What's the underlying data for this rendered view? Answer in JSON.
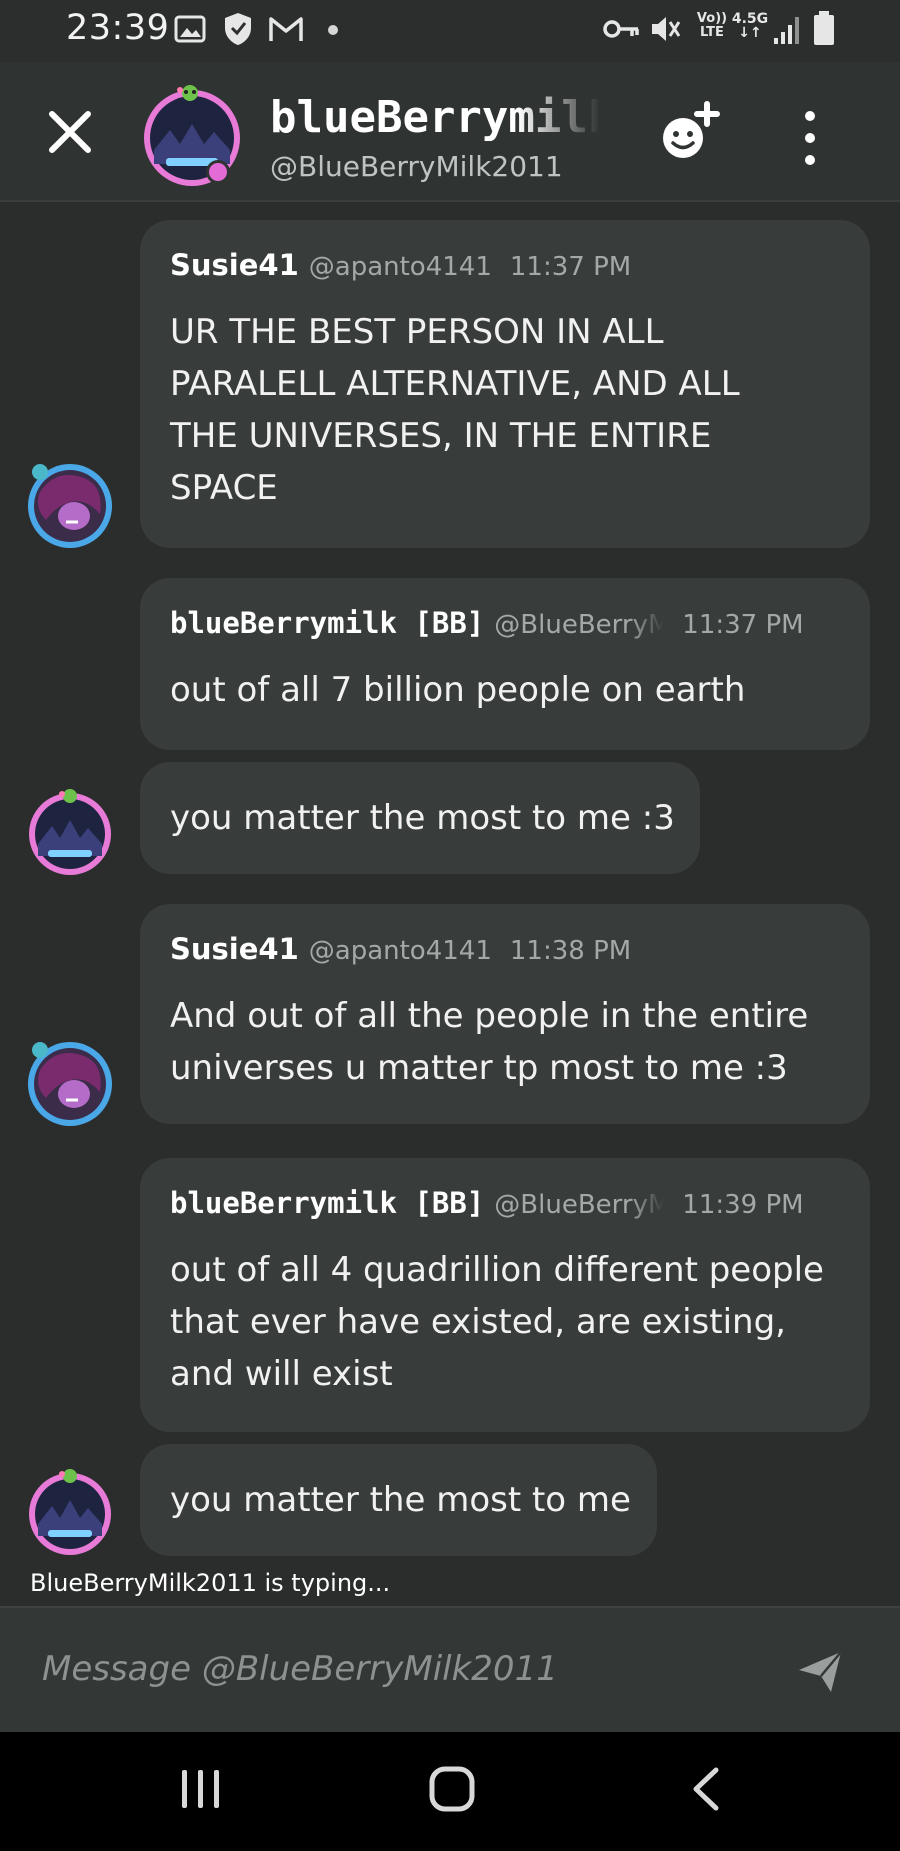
{
  "status_bar": {
    "time": "23:39",
    "network_type": "4.5G",
    "volte": "Vo)) LTE",
    "icons": [
      "gallery-icon",
      "shield-icon",
      "gmail-icon",
      "dot-icon",
      "key-icon",
      "mute-icon",
      "signal-icon",
      "battery-icon"
    ]
  },
  "header": {
    "name": "blueBerrymilk",
    "handle": "@BlueBerryMilk2011",
    "status_color": "#e26bd6",
    "icons": [
      "close-icon",
      "add-friend-icon",
      "more-icon"
    ]
  },
  "messages": [
    {
      "author": "Susie41",
      "handle": "@apanto4141",
      "time": "11:37 PM",
      "text": [
        "UR THE BEST PERSON IN ALL",
        "PARALELL ALTERNATIVE, AND ALL",
        "THE UNIVERSES, IN THE ENTIRE",
        "SPACE"
      ]
    },
    {
      "author": "blueBerrymilk [BB]",
      "handle": "@BlueBerryM",
      "time": "11:37 PM",
      "text": [
        "out of all 7 billion people on earth"
      ]
    },
    {
      "text": [
        "you matter the most to me :3"
      ]
    },
    {
      "author": "Susie41",
      "handle": "@apanto4141",
      "time": "11:38 PM",
      "text": [
        "And out of all the people in the entire",
        "universes u matter tp most to me :3"
      ]
    },
    {
      "author": "blueBerrymilk [BB]",
      "handle": "@BlueBerryM",
      "time": "11:39 PM",
      "text": [
        "out of all 4 quadrillion different people",
        "that ever have existed, are existing,",
        "and will exist"
      ]
    },
    {
      "text": [
        "you matter the most to me"
      ]
    }
  ],
  "typing_indicator": "BlueBerryMilk2011 is typing...",
  "composer": {
    "placeholder": "Message @BlueBerryMilk2011",
    "send_icon": "send-icon"
  },
  "nav_bar": {
    "icons": [
      "recent-apps-icon",
      "home-icon",
      "back-icon"
    ]
  },
  "colors": {
    "background": "#2b2d2c",
    "bubble": "#383c3a",
    "accent_pink": "#e26bd6",
    "accent_blue": "#4aa8e8"
  }
}
